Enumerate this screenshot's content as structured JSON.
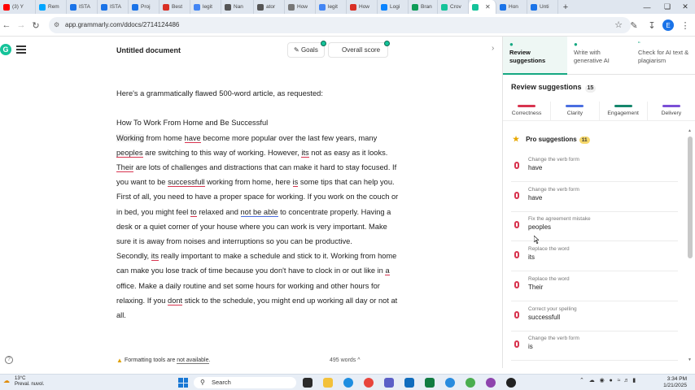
{
  "browser": {
    "tabs": [
      {
        "label": "(3) Y",
        "color": "#ff0000"
      },
      {
        "label": "Rem",
        "color": "#00a6ff"
      },
      {
        "label": "ISTA",
        "color": "#1a73e8"
      },
      {
        "label": "ISTA",
        "color": "#1a73e8"
      },
      {
        "label": "Proj",
        "color": "#1a73e8"
      },
      {
        "label": "Best",
        "color": "#d93025"
      },
      {
        "label": "legit",
        "color": "#4285f4"
      },
      {
        "label": "Nan",
        "color": "#555555"
      },
      {
        "label": "ator",
        "color": "#555555"
      },
      {
        "label": "How",
        "color": "#777777"
      },
      {
        "label": "legit",
        "color": "#4285f4"
      },
      {
        "label": "How",
        "color": "#d93025"
      },
      {
        "label": "Logi",
        "color": "#0a84ff"
      },
      {
        "label": "Bran",
        "color": "#0f9d58"
      },
      {
        "label": "Crov",
        "color": "#15c39a"
      },
      {
        "label": "",
        "color": "#15c39a",
        "active": true
      },
      {
        "label": "Hon",
        "color": "#1a73e8"
      },
      {
        "label": "Unti",
        "color": "#1a73e8"
      }
    ],
    "new_tab": "+",
    "url": "app.grammarly.com/ddocs/2714124486"
  },
  "doc": {
    "title": "Untitled document",
    "goals_label": "Goals",
    "overall_score_label": "Overall score",
    "formatting_notice_pre": "Formatting tools are ",
    "formatting_notice_link": "not available",
    "formatting_notice_post": ".",
    "word_count": "495 words ^"
  },
  "text": {
    "intro": "Here's a grammatically flawed 500-word article, as requested:",
    "heading": "How To Work From Home and Be Successful",
    "p1_a": "Working",
    "p1_b": " from home ",
    "p1_c": "have",
    "p1_d": " become more popular over the last few years, many ",
    "p1_e": "peoples",
    "p1_f": " are switching to this way of working. However, ",
    "p1_g": "its",
    "p1_h": " not as easy as it looks. ",
    "p1_i": "Their",
    "p1_j": " are lots of challenges and distractions that can make it hard to stay focused. If you want to be ",
    "p1_k": "successfull",
    "p1_l": " working from home, here ",
    "p1_m": "is",
    "p1_n": " some tips that can help you.",
    "p2_a": "First of all, you need to have a proper space for working. If you work on the couch or in bed, you might feel ",
    "p2_b": "to",
    "p2_c": " relaxed and ",
    "p2_d": "not be able",
    "p2_e": " to concentrate properly. Having a desk or a quiet corner of your house where you can work is very important. Make sure it is away from noises and interruptions so you can be productive.",
    "p3_a": "Secondly, ",
    "p3_b": "its",
    "p3_c": " really important to make a schedule and stick to it. Working from home can make you lose track of time because you don't have to clock in or out like in ",
    "p3_d": "a",
    "p3_e": " office. Make a daily routine and set some hours for working and other hours for relaxing. If you ",
    "p3_f": "dont",
    "p3_g": " stick to the schedule, you might end up working all day or not at all."
  },
  "panel": {
    "tabs": [
      {
        "label": "Review suggestions"
      },
      {
        "label": "Write with generative AI"
      },
      {
        "label": "Check for AI text & plagiarism"
      }
    ],
    "title": "Review suggestions",
    "count": "15",
    "categories": [
      {
        "label": "Correctness",
        "color": "#d8344f"
      },
      {
        "label": "Clarity",
        "color": "#4a6ee0"
      },
      {
        "label": "Engagement",
        "color": "#15866c"
      },
      {
        "label": "Delivery",
        "color": "#7b4fd6"
      }
    ],
    "pro_label": "Pro suggestions",
    "pro_count": "11",
    "suggestions": [
      {
        "type": "Change the verb form",
        "word": "have"
      },
      {
        "type": "Change the verb form",
        "word": "have"
      },
      {
        "type": "Fix the agreement mistake",
        "word": "peoples"
      },
      {
        "type": "Replace the word",
        "word": "its"
      },
      {
        "type": "Replace the word",
        "word": "Their"
      },
      {
        "type": "Correct your spelling",
        "word": "successfull"
      },
      {
        "type": "Change the verb form",
        "word": "is"
      }
    ]
  },
  "taskbar": {
    "temp": "13°C",
    "weather": "Preval. nuvol.",
    "search": "Search",
    "time": "3:34 PM",
    "date": "1/21/2025"
  }
}
